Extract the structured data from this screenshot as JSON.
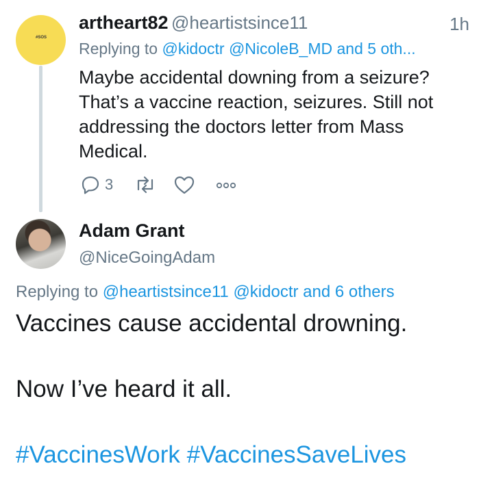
{
  "tweet1": {
    "display_name": "artheart82",
    "handle": "@heartistsince11",
    "time": "1h",
    "avatar_tag": "#SOS",
    "replying_prefix": "Replying to",
    "replying_users": [
      "@kidoctr",
      "@NicoleB_MD"
    ],
    "replying_more": "and 5 oth...",
    "text": "Maybe accidental downing from a seizure? That’s a vaccine reaction, seizures. Still not addressing the doctors letter from Mass Medical.",
    "reply_count": "3",
    "icons": [
      "reply-icon",
      "retweet-icon",
      "like-icon",
      "more-icon"
    ]
  },
  "tweet2": {
    "display_name": "Adam Grant",
    "handle": "@NiceGoingAdam",
    "replying_prefix": "Replying to",
    "replying_users": [
      "@heartistsince11",
      "@kidoctr"
    ],
    "replying_more": "and 6 others",
    "line1": "Vaccines cause accidental drowning.",
    "line2": "Now I’ve heard it all.",
    "hashtags": [
      "#VaccinesWork",
      "#VaccinesSaveLives"
    ]
  },
  "colors": {
    "link": "#1b95e0",
    "secondary_text": "#657786",
    "thread_line": "#cfd9de",
    "avatar1_bg": "#f7dc55"
  }
}
